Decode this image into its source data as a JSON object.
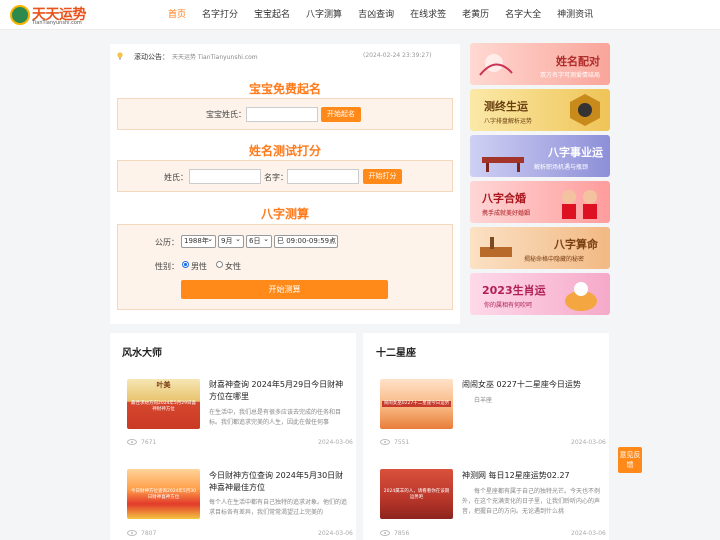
{
  "logo": {
    "name": "天天运势",
    "domain": "TianTianyunshi.com"
  },
  "nav": [
    "首页",
    "名字打分",
    "宝宝起名",
    "八字测算",
    "吉凶查询",
    "在线求签",
    "老黄历",
    "名字大全",
    "神测资讯"
  ],
  "notice": {
    "label": "滚动公告：",
    "text": "天天运势 TianTianyunshi.com",
    "time": "(2024-02-24 23:39:27)"
  },
  "baby": {
    "title": "宝宝免费起名",
    "surname_label": "宝宝姓氏：",
    "button": "开始起名"
  },
  "score": {
    "title": "姓名测试打分",
    "surname_label": "姓氏：",
    "name_label": "名字：",
    "button": "开始打分"
  },
  "bazi": {
    "title": "八字测算",
    "date_label": "公历：",
    "year": "1988年",
    "month": "9月",
    "day": "6日",
    "hour": "巳 09:00-09:59点",
    "gender_label": "性别：",
    "male": "男性",
    "female": "女性",
    "button": "开始测算"
  },
  "banners": [
    {
      "title": "姓名配对",
      "sub": "双方名字可测爱情结局"
    },
    {
      "title": "测终生运",
      "sub": "八字排盘解析运势"
    },
    {
      "title": "八字事业运",
      "sub": "解析职场机遇与瓶颈"
    },
    {
      "title": "八字合婚",
      "sub": "携手成就美好婚姻"
    },
    {
      "title": "八字算命",
      "sub": "揭秘命格中隐藏的秘密"
    },
    {
      "title": "2023生肖运",
      "sub": "你的属相有何吹呵"
    }
  ],
  "fengshui": {
    "heading": "风水大师",
    "articles": [
      {
        "thumb_top": "叶美",
        "thumb": "最佳求财方向2024年5月29日喜神财神方位",
        "title": "财喜神查询 2024年5月29日今日财神方位在哪里",
        "desc": "在生活中，我们总是有很多应该去完成的任务和目标。我们都追求完美的人生，因此在做任何事",
        "views": "7671",
        "date": "2024-03-06"
      },
      {
        "thumb_top": "",
        "thumb": "今日财神方位查询2024年5月30日财神喜神方位",
        "title": "今日财神方位查询 2024年5月30日财神喜神最佳方位",
        "desc": "每个人在生活中都有自己独特的追求对象。他们的追求目标各有差异，我们常常渴望过上完美的",
        "views": "7807",
        "date": "2024-03-06"
      }
    ]
  },
  "stars": {
    "heading": "十二星座",
    "articles": [
      {
        "thumb": "闹闹女巫0227十二星座今日运势",
        "title": "闹闹女巫 0227十二星座今日运势",
        "desc": "白羊座",
        "views": "7551",
        "date": "2024-03-06"
      },
      {
        "thumb": "2024属羊的人，请看看你在该期运势吧",
        "title": "神测网 每日12星座运势02.27",
        "desc": "每个星座都有属于自己的独特光芒。今天也不例外，在这个充满变化的日子里，让我们聆听内心的声音，把握自己的方向。无论遇到什么挑",
        "views": "7856",
        "date": "2024-03-06"
      }
    ]
  },
  "feedback": "意见反馈",
  "colors": {
    "accent": "#ff7a1a",
    "button": "#ff8a1a",
    "form_bg": "#fdf3ea"
  }
}
